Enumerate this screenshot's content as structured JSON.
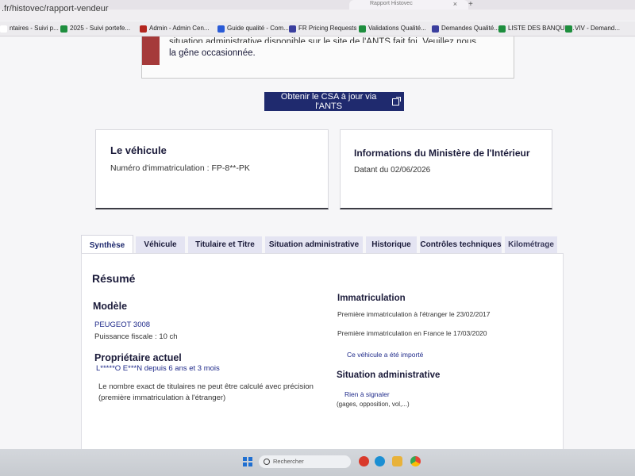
{
  "browser": {
    "url": ".fr/histovec/rapport-vendeur",
    "tab_title": "Rapport Histovec",
    "tab_close": "×",
    "new_tab": "+"
  },
  "bookmarks": [
    {
      "label": "ntaires - Suivi p...",
      "icon": "folder-icon",
      "color": "#ffffff"
    },
    {
      "label": "2025 - Suivi portefe...",
      "icon": "sheets-icon",
      "color": "#1e8e3e"
    },
    {
      "label": "Admin - Admin Cen...",
      "icon": "admin-icon",
      "color": "#b3261e"
    },
    {
      "label": "Guide qualité - Com...",
      "icon": "doc-icon",
      "color": "#2a5bd7"
    },
    {
      "label": "FR Pricing Requests",
      "icon": "slides-icon",
      "color": "#3b3f9e"
    },
    {
      "label": "Validations Qualité...",
      "icon": "sheets-icon",
      "color": "#1e8e3e"
    },
    {
      "label": "Demandes Qualité...",
      "icon": "slides-icon",
      "color": "#3b3f9e"
    },
    {
      "label": "LISTE DES BANQUE...",
      "icon": "sheets-icon",
      "color": "#1e8e3e"
    },
    {
      "label": "VIV - Demand...",
      "icon": "sheets-icon",
      "color": "#1e8e3e"
    }
  ],
  "notice": {
    "line_cut": "situation administrative disponible sur le site de l'ANTS fait foi. Veuillez nous excuser pour",
    "line": "la gêne occasionnée."
  },
  "csa_button": "Obtenir le CSA à jour via l'ANTS",
  "vehicle_card": {
    "title": "Le véhicule",
    "registration": "Numéro d'immatriculation : FP-8**-PK"
  },
  "ministry_card": {
    "title": "Informations du Ministère de l'Intérieur",
    "date": "Datant du 02/06/2026"
  },
  "tabs": [
    "Synthèse",
    "Véhicule",
    "Titulaire et Titre",
    "Situation administrative",
    "Historique",
    "Contrôles techniques",
    "Kilométrage"
  ],
  "summary": {
    "title": "Résumé",
    "model_heading": "Modèle",
    "model": "PEUGEOT 3008",
    "fiscal_power": "Puissance fiscale : 10 ch",
    "owner_heading": "Propriétaire actuel",
    "owner": "L*****O E***N depuis 6 ans et 3 mois",
    "owner_note_1": "Le nombre exact de titulaires ne peut être calculé avec précision",
    "owner_note_2": "(première immatriculation à l'étranger)",
    "registration_heading": "Immatriculation",
    "first_reg_abroad": "Première immatriculation à l'étranger le 23/02/2017",
    "first_reg_france": "Première immatriculation en France le 17/03/2020",
    "imported": "Ce véhicule a été importé",
    "admin_heading": "Situation administrative",
    "admin_status": "Rien à signaler",
    "admin_detail": "(gages, opposition, vol,...)"
  },
  "taskbar": {
    "search_placeholder": "Rechercher"
  }
}
